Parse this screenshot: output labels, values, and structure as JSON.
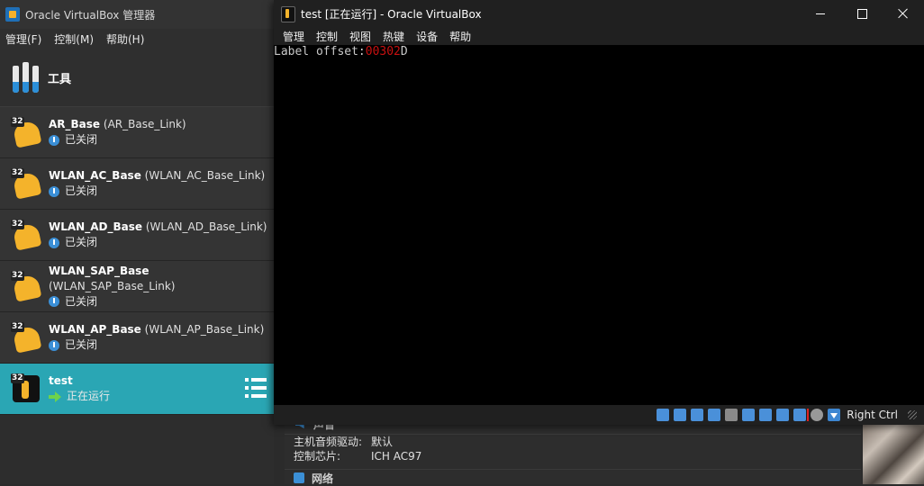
{
  "manager": {
    "title": "Oracle VirtualBox 管理器",
    "menu": [
      "管理(F)",
      "控制(M)",
      "帮助(H)"
    ],
    "tools_label": "工具",
    "vms": [
      {
        "name": "AR_Base",
        "link": "(AR_Base_Link)",
        "status": "已关闭",
        "badge": "32",
        "state": "off"
      },
      {
        "name": "WLAN_AC_Base",
        "link": "(WLAN_AC_Base_Link)",
        "status": "已关闭",
        "badge": "32",
        "state": "off"
      },
      {
        "name": "WLAN_AD_Base",
        "link": "(WLAN_AD_Base_Link)",
        "status": "已关闭",
        "badge": "32",
        "state": "off"
      },
      {
        "name": "WLAN_SAP_Base",
        "link": "(WLAN_SAP_Base_Link)",
        "status": "已关闭",
        "badge": "32",
        "state": "off"
      },
      {
        "name": "WLAN_AP_Base",
        "link": "(WLAN_AP_Base_Link)",
        "status": "已关闭",
        "badge": "32",
        "state": "off"
      },
      {
        "name": "test",
        "link": "",
        "status": "正在运行",
        "badge": "32",
        "state": "running"
      }
    ],
    "details": {
      "section_sound": "声音",
      "rows": [
        {
          "key": "主机音频驱动:",
          "value": "默认"
        },
        {
          "key": "控制芯片:",
          "value": "ICH AC97"
        }
      ],
      "section_network": "网络"
    }
  },
  "vm_window": {
    "title": "test [正在运行] - Oracle VirtualBox",
    "menu": [
      "管理",
      "控制",
      "视图",
      "热键",
      "设备",
      "帮助"
    ],
    "console": {
      "prefix": "Label offset:",
      "value": "00302",
      "suffix": "D"
    },
    "host_key": "Right Ctrl"
  },
  "colors": {
    "selected_row": "#2aa6b4",
    "console_value": "#c81010",
    "power_icon": "#3b8fd6",
    "running_icon": "#6dd34b"
  }
}
